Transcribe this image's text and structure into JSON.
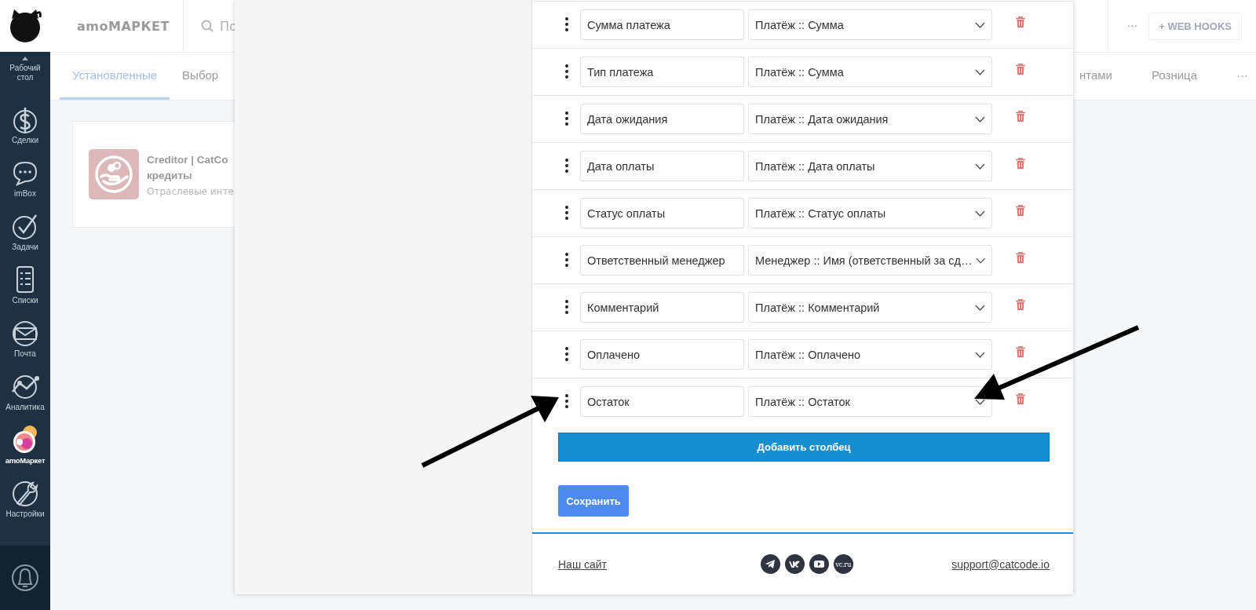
{
  "top_bar": {
    "title": "amoМАРКЕТ",
    "search": {
      "placeholder": "По"
    },
    "more": "···",
    "webhooks_button": "+ WEB HOOKS"
  },
  "sidebar": {
    "items": [
      {
        "kind": "desk",
        "label": "Рабочий стол",
        "selected": false
      },
      {
        "kind": "deals",
        "label": "Сделки",
        "selected": false
      },
      {
        "kind": "chat",
        "label": "imBox",
        "selected": false
      },
      {
        "kind": "tasks",
        "label": "Задачи",
        "selected": false
      },
      {
        "kind": "lists",
        "label": "Списки",
        "selected": false
      },
      {
        "kind": "mail",
        "label": "Почта",
        "selected": false
      },
      {
        "kind": "stats",
        "label": "Аналитика",
        "selected": false
      },
      {
        "kind": "market",
        "label": "amoМаркет",
        "selected": true
      },
      {
        "kind": "settings",
        "label": "Настройки",
        "selected": false
      }
    ]
  },
  "tabs": [
    {
      "label": "Установленные",
      "selected": true
    },
    {
      "label": "Выбор",
      "selected": false
    },
    {
      "label": "нтами",
      "selected": false
    },
    {
      "label": "Розница",
      "selected": false
    },
    {
      "label": "···",
      "selected": false
    }
  ],
  "card": {
    "title": [
      "Creditor | CatCo",
      "кредиты"
    ],
    "category": "Отраслевые инте"
  },
  "modal": {
    "rows": [
      {
        "name": "Сумма платежа",
        "field": "Платёж :: Сумма"
      },
      {
        "name": "Тип платежа",
        "field": "Платёж :: Сумма"
      },
      {
        "name": "Дата ожидания",
        "field": "Платёж :: Дата ожидания"
      },
      {
        "name": "Дата оплаты",
        "field": "Платёж :: Дата оплаты"
      },
      {
        "name": "Статус оплаты",
        "field": "Платёж :: Статус оплаты"
      },
      {
        "name": "Ответственный менеджер",
        "field": "Менеджер :: Имя (ответственный за сд…"
      },
      {
        "name": "Комментарий",
        "field": "Платёж :: Комментарий"
      },
      {
        "name": "Оплачено",
        "field": "Платёж :: Оплачено"
      },
      {
        "name": "Остаток",
        "field": "Платёж :: Остаток"
      }
    ],
    "add_button": "Добавить столбец",
    "save_button": "Сохранить",
    "footer": {
      "site_link": "Наш сайт",
      "socials": [
        {
          "kind": "telegram"
        },
        {
          "kind": "vk"
        },
        {
          "kind": "youtube"
        },
        {
          "kind": "vc",
          "text": "vc.ru"
        }
      ],
      "email": "support@catcode.io"
    }
  }
}
